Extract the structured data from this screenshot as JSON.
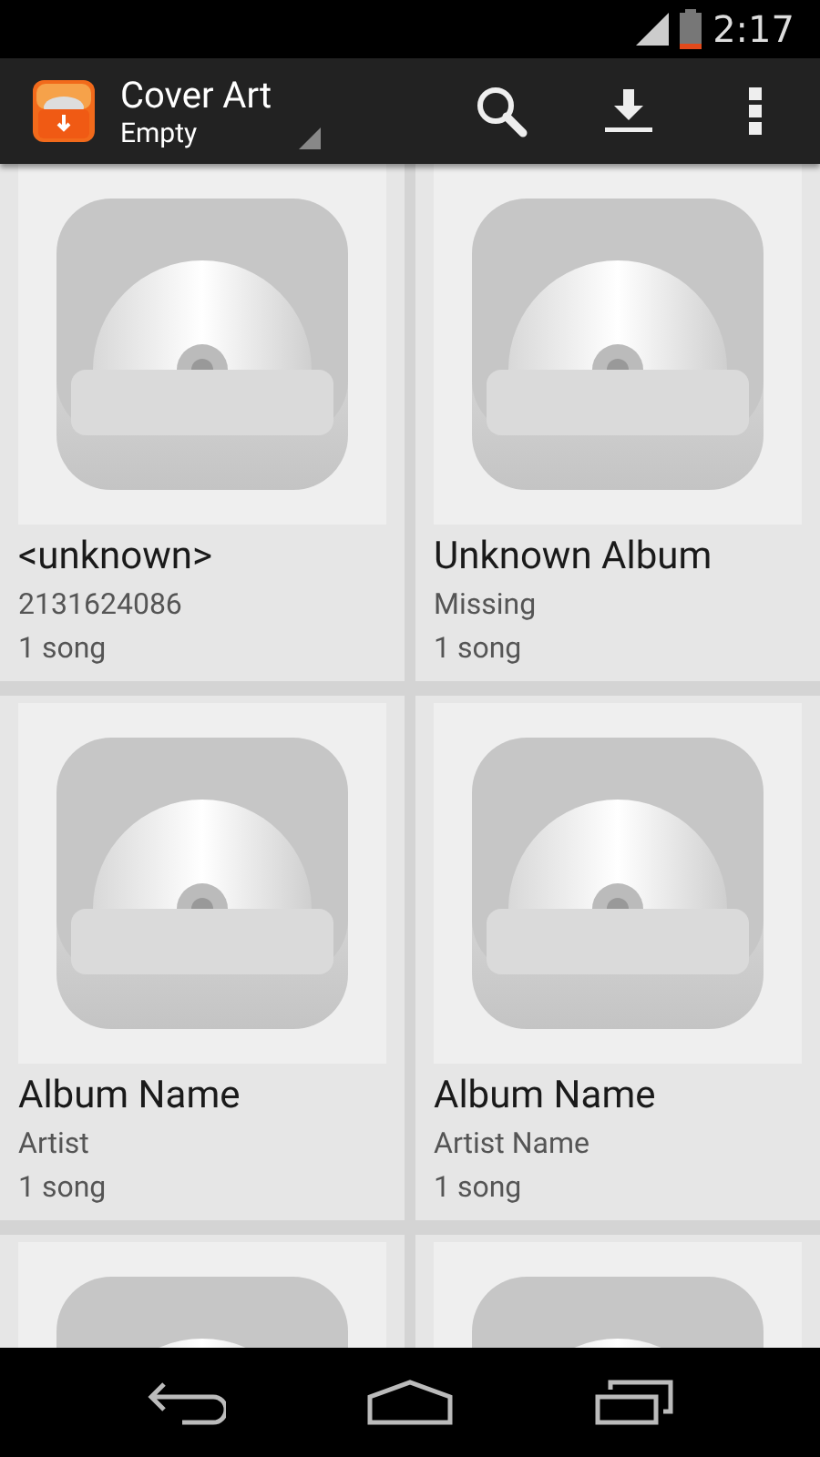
{
  "status_bar": {
    "time": "2:17"
  },
  "action_bar": {
    "title": "Cover Art",
    "subtitle": "Empty"
  },
  "albums": [
    {
      "kind": "album",
      "title": "<unknown>",
      "artist": "2131624086",
      "count": "1 song"
    },
    {
      "kind": "album",
      "title": "Unknown Album",
      "artist": "Missing",
      "count": "1 song"
    },
    {
      "kind": "album",
      "title": "Album Name",
      "artist": "Artist",
      "count": "1 song"
    },
    {
      "kind": "album",
      "title": "Album Name",
      "artist": "Artist Name",
      "count": "1 song"
    },
    {
      "kind": "album"
    },
    {
      "kind": "album"
    }
  ]
}
